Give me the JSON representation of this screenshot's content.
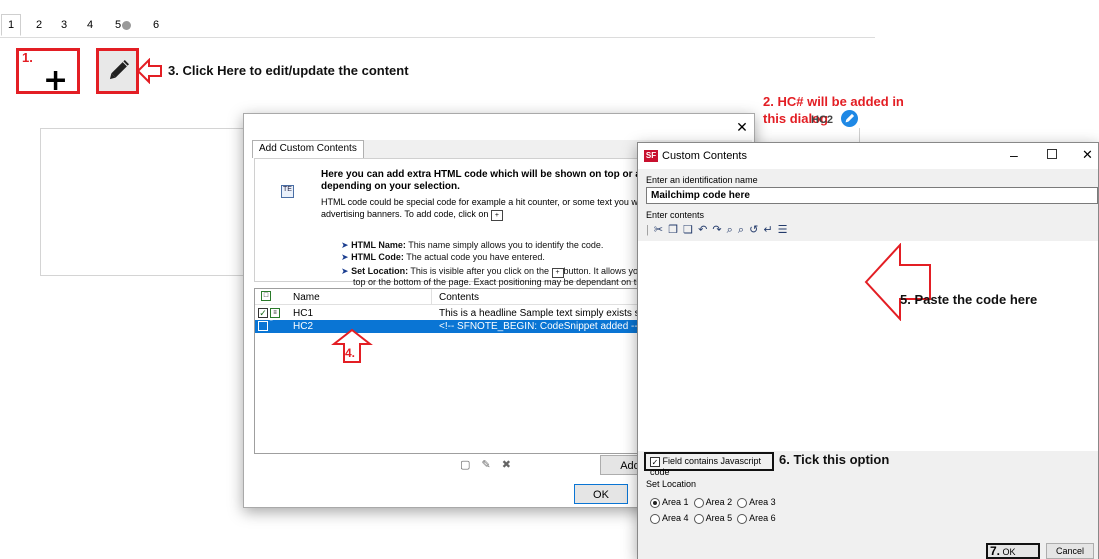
{
  "page_tabs": [
    {
      "label": "1"
    },
    {
      "label": "2"
    },
    {
      "label": "3"
    },
    {
      "label": "4"
    },
    {
      "label": "5"
    },
    {
      "label": "6"
    }
  ],
  "annotations": {
    "step1": "1.",
    "step2_prefix": "2. HC# ",
    "step2_rest": "will be added in",
    "step2_line2": "this dialog",
    "step3": "3. Click Here to edit/update the content",
    "step4": "4.",
    "step5": "5. Paste the code here",
    "step6": "6. Tick this option",
    "step7": "7."
  },
  "overlap_text": "HC2",
  "add_dialog": {
    "tab_label": "Add Custom Contents",
    "heading": "Here you can add extra HTML code which will be shown on top or at the bot",
    "heading_line2": "depending on your selection.",
    "desc_line1": "HTML code could be special code for example a hit counter, or some text you want to di",
    "desc_line2": "advertising banners. To add code, click on",
    "bullets": [
      {
        "term": "HTML Name:",
        "text": "This name simply allows you to identify the code."
      },
      {
        "term": "HTML Code:",
        "text": "The actual code you have entered."
      },
      {
        "term": "Set Location:",
        "text": "This is visible after you click on the",
        "text2": "button. It allows you to",
        "line2": "top or the bottom of the page. Exact positioning may be dependant on the pag"
      }
    ],
    "columns": {
      "name": "Name",
      "contents": "Contents"
    },
    "rows": [
      {
        "name": "HC1",
        "contents": "This is a headline Sample text simply exists so you ca",
        "checked": true
      },
      {
        "name": "HC2",
        "contents": "<!-- SFNOTE_BEGIN: CodeSnippet added -->",
        "checked": false
      }
    ],
    "add_button": "Add",
    "ok_button": "OK"
  },
  "custom_dialog": {
    "app_badge": "SF",
    "title": "Custom Contents",
    "id_label": "Enter an identification name",
    "id_value": "Mailchimp code here",
    "contents_label": "Enter contents",
    "js_checkbox_label": "Field contains Javascript code",
    "js_checked": true,
    "location_label": "Set Location",
    "areas": [
      {
        "label": "Area 1",
        "selected": true
      },
      {
        "label": "Area 2",
        "selected": false
      },
      {
        "label": "Area 3",
        "selected": false
      },
      {
        "label": "Area 4",
        "selected": false
      },
      {
        "label": "Area 5",
        "selected": false
      },
      {
        "label": "Area 6",
        "selected": false
      }
    ],
    "ok_button": "OK",
    "cancel_button": "Cancel"
  },
  "colors": {
    "accent_red": "#e31e24",
    "selection_blue": "#0a75d4",
    "edit_badge_blue": "#1e88e5"
  }
}
